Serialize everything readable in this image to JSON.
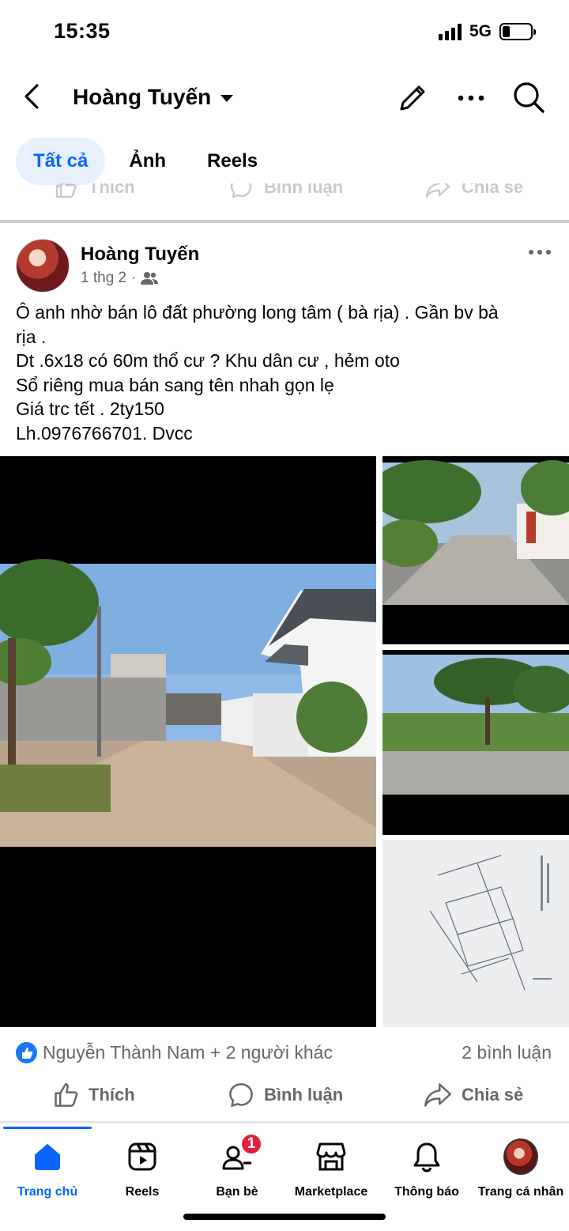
{
  "status_bar": {
    "time": "15:35",
    "network": "5G",
    "battery_level": 0.25
  },
  "header": {
    "title": "Hoàng Tuyến",
    "icons": [
      "back-icon",
      "caret-down-icon",
      "edit-icon",
      "more-icon",
      "search-icon"
    ]
  },
  "filter_tabs": [
    {
      "label": "Tất cả",
      "active": true
    },
    {
      "label": "Ảnh",
      "active": false
    },
    {
      "label": "Reels",
      "active": false
    }
  ],
  "post": {
    "author": "Hoàng Tuyến",
    "date": "1 thg 2",
    "audience_icon": "friends-icon",
    "text_lines": [
      "Ô anh nhờ bán lô đất phường long tâm ( bà rịa) . Gần bv bà",
      "rịa .",
      "Dt .6x18 có 60m thổ cư ? Khu dân cư , hẻm oto",
      "Sổ riêng mua bán sang tên nhah gọn lẹ",
      "Giá trc tết . 2ty150",
      "Lh.0976766701. Dvcc"
    ],
    "reactions_text": "Nguyễn Thành Nam + 2 người khác",
    "comments_text": "2 bình luận",
    "actions": {
      "like": "Thích",
      "comment": "Bình luận",
      "share": "Chia sẻ"
    }
  },
  "bottom_nav": [
    {
      "label": "Trang chủ",
      "icon": "home-icon",
      "active": true
    },
    {
      "label": "Reels",
      "icon": "reels-icon",
      "active": false
    },
    {
      "label": "Bạn bè",
      "icon": "friends-icon",
      "active": false,
      "badge": "1"
    },
    {
      "label": "Marketplace",
      "icon": "marketplace-icon",
      "active": false
    },
    {
      "label": "Thông báo",
      "icon": "bell-icon",
      "active": false
    },
    {
      "label": "Trang cá nhân",
      "icon": "profile-avatar",
      "active": false
    }
  ],
  "colors": {
    "accent": "#0866ff",
    "like_blue": "#1877f2",
    "secondary_text": "#65676b",
    "badge_red": "#e41e3f"
  }
}
